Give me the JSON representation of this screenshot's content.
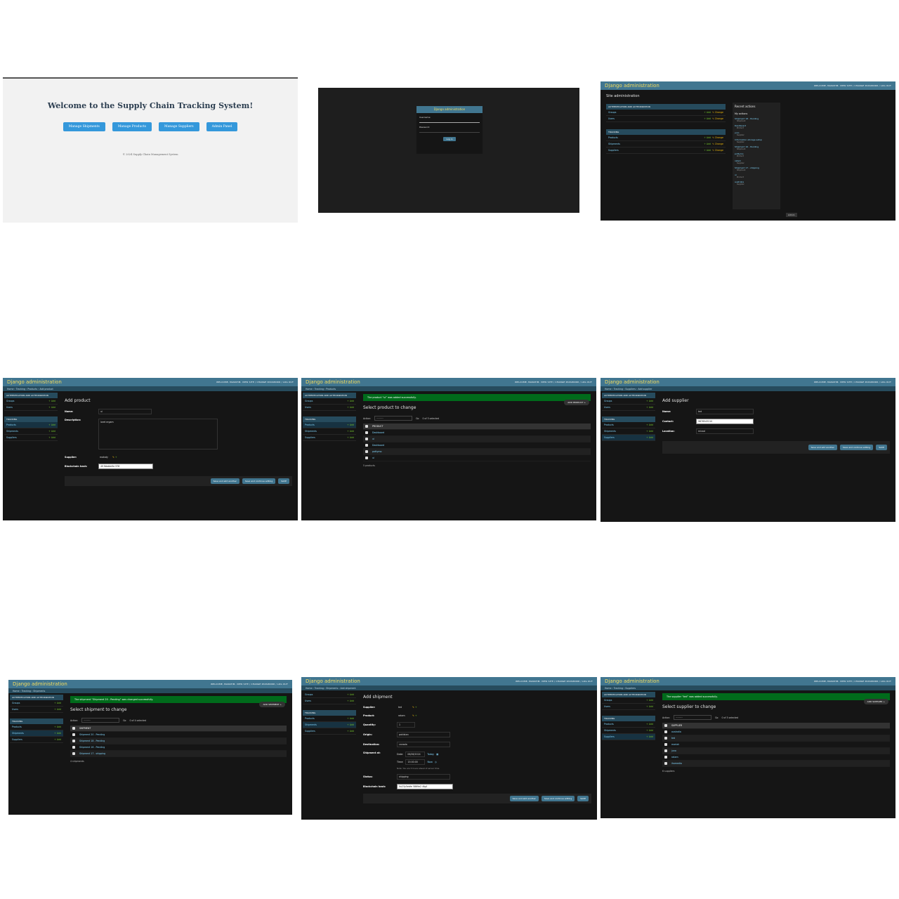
{
  "welcome": {
    "heading": "Welcome to the Supply Chain Tracking System!",
    "buttons": [
      "Manage Shipments",
      "Manage Products",
      "Manage Suppliers",
      "Admin Panel"
    ],
    "footer": "© 2024 Supply Chain Management System"
  },
  "login": {
    "title": "Django administration",
    "username_label": "Username:",
    "password_label": "Password:",
    "button": "Log in"
  },
  "common": {
    "brand": "Django administration",
    "user_tools": "WELCOME, MANATIM. VIEW SITE / CHANGE PASSWORD / LOG OUT",
    "auth_caption": "AUTHENTICATION AND AUTHORIZATION",
    "tracking_caption": "TRACKING",
    "groups": "Groups",
    "users": "Users",
    "products": "Products",
    "shipments": "Shipments",
    "suppliers": "Suppliers",
    "add": "+ Add",
    "change": "✎ Change",
    "action": "Action:",
    "go": "Go",
    "dashes": "---------",
    "save_add": "Save and add another",
    "save_continue": "Save and continue editing",
    "save": "SAVE"
  },
  "home": {
    "title": "Site administration",
    "recent_title": "Recent actions",
    "my_actions": "My actions",
    "recent_items": [
      {
        "name": "Shipment 18 - Pending",
        "type": "Shipment"
      },
      {
        "name": "Dashboard",
        "type": "Product"
      },
      {
        "name": "juno",
        "type": "Supplier"
      },
      {
        "name": "Information storage setup",
        "type": "Supplier"
      },
      {
        "name": "Shipment 16 - Pending",
        "type": "Shipment"
      },
      {
        "name": "pottymo",
        "type": "Product"
      },
      {
        "name": "ratam",
        "type": "Supplier"
      },
      {
        "name": "Shipment 17 - shipping",
        "type": "Shipment"
      },
      {
        "name": "ui",
        "type": "Product"
      },
      {
        "name": "australia",
        "type": "Supplier"
      }
    ],
    "footer_button": "Admin"
  },
  "add_product": {
    "crumbs": "Home › Tracking › Products › Add product",
    "title": "Add product",
    "name_label": "Name:",
    "name_value": "ui",
    "desc_label": "Description:",
    "desc_value": "loret ergam",
    "supplier_label": "Supplier:",
    "supplier_value": "makaty",
    "blockchain_label": "Blockchain hash:",
    "blockchain_value": "49 fbbdde9e 978"
  },
  "product_list": {
    "crumbs": "Home › Tracking › Products",
    "message": "The product “ui” was added successfully.",
    "title": "Select product to change",
    "add_button": "ADD PRODUCT +",
    "selected": "0 of 5 selected",
    "header": "PRODUCT",
    "rows": [
      "Dashboard",
      "ui",
      "Dashboard",
      "pottymo",
      "ui"
    ],
    "count": "5 products"
  },
  "add_supplier": {
    "crumbs": "Home › Tracking › Suppliers › Add supplier",
    "title": "Add supplier",
    "name_label": "Name:",
    "name_value": "ted",
    "contact_label": "Contact:",
    "contact_value": "9876543210",
    "location_label": "Location:",
    "location_value": "mivad"
  },
  "shipment_list": {
    "crumbs": "Home › Tracking › Shipments",
    "message": "The shipment “Shipment 20 - Pending” was changed successfully.",
    "title": "Select shipment to change",
    "add_button": "ADD SHIPMENT +",
    "selected": "0 of 4 selected",
    "header": "SHIPMENT",
    "rows": [
      "Shipment 20 - Pending",
      "Shipment 18 - Pending",
      "Shipment 16 - Pending",
      "Shipment 17 - shipping"
    ],
    "count": "4 shipments"
  },
  "add_shipment": {
    "crumbs": "Home › Tracking › Shipments › Add shipment",
    "title": "Add shipment",
    "supplier_label": "Supplier:",
    "supplier_value": "ted",
    "product_label": "Product:",
    "product_value": "ratam",
    "quantity_label": "Quantity:",
    "quantity_value": "1",
    "origin_label": "Origin:",
    "origin_value": "pakistan",
    "destination_label": "Destination:",
    "destination_value": "canada",
    "shipped_label": "Shipment at:",
    "date_label": "Date:",
    "date_value": "06/06/2024",
    "today": "Today",
    "time_label": "Time:",
    "time_value": "15:00:00",
    "now": "Now",
    "tz_note": "Note: You are 5 hours ahead of server time.",
    "status_label": "Status:",
    "status_value": "shipping",
    "blockchain_label": "Blockchain hash:",
    "blockchain_value": "0x23y5ebfe 5869e2 4fg4"
  },
  "supplier_list": {
    "crumbs": "Home › Tracking › Suppliers",
    "message": "The supplier “ted” was added successfully.",
    "title": "Select supplier to change",
    "add_button": "ADD SUPPLIER +",
    "selected": "0 of 5 selected",
    "header": "SUPPLIER",
    "rows": [
      "australia",
      "ted",
      "mariah",
      "juno",
      "ratam",
      "ihamedia"
    ],
    "count": "6 suppliers"
  }
}
